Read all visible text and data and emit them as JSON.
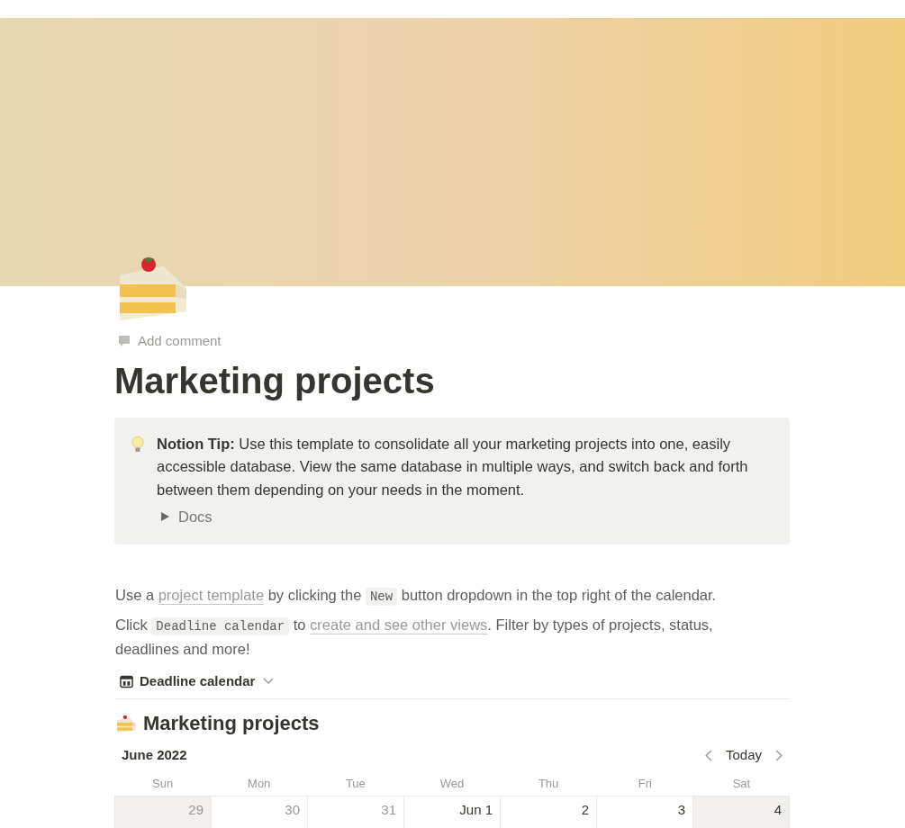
{
  "page": {
    "add_comment": "Add comment",
    "title": "Marketing projects"
  },
  "callout": {
    "label": "Notion Tip:",
    "text": "Use this template to consolidate all your marketing projects into one, easily accessible database. View the same database in multiple ways, and switch back and forth between them depending on your needs in the moment.",
    "toggle": {
      "label": "Docs",
      "expanded": false
    }
  },
  "paragraphs": [
    [
      {
        "kind": "text",
        "text": "Use a "
      },
      {
        "kind": "link",
        "text": "project template"
      },
      {
        "kind": "text",
        "text": " by clicking the "
      },
      {
        "kind": "code",
        "text": "New"
      },
      {
        "kind": "text",
        "text": " button dropdown in the top right of the calendar."
      }
    ],
    [
      {
        "kind": "text",
        "text": "Click "
      },
      {
        "kind": "code",
        "text": "Deadline calendar"
      },
      {
        "kind": "text",
        "text": " to "
      },
      {
        "kind": "link",
        "text": "create and see other views"
      },
      {
        "kind": "text",
        "text": ". Filter by types of projects, status, deadlines and more!"
      }
    ]
  ],
  "view_switcher": {
    "label": "Deadline calendar"
  },
  "database": {
    "title": "Marketing projects",
    "month": "June 2022",
    "today_button": "Today",
    "weekdays": [
      "Sun",
      "Mon",
      "Tue",
      "Wed",
      "Thu",
      "Fri",
      "Sat"
    ],
    "days": [
      {
        "label": "29",
        "outside_month": true,
        "weekend": true
      },
      {
        "label": "30",
        "outside_month": true,
        "weekend": false
      },
      {
        "label": "31",
        "outside_month": true,
        "weekend": false
      },
      {
        "label": "Jun 1",
        "outside_month": false,
        "weekend": false
      },
      {
        "label": "2",
        "outside_month": false,
        "weekend": false
      },
      {
        "label": "3",
        "outside_month": false,
        "weekend": false
      },
      {
        "label": "4",
        "outside_month": false,
        "weekend": true
      }
    ]
  }
}
